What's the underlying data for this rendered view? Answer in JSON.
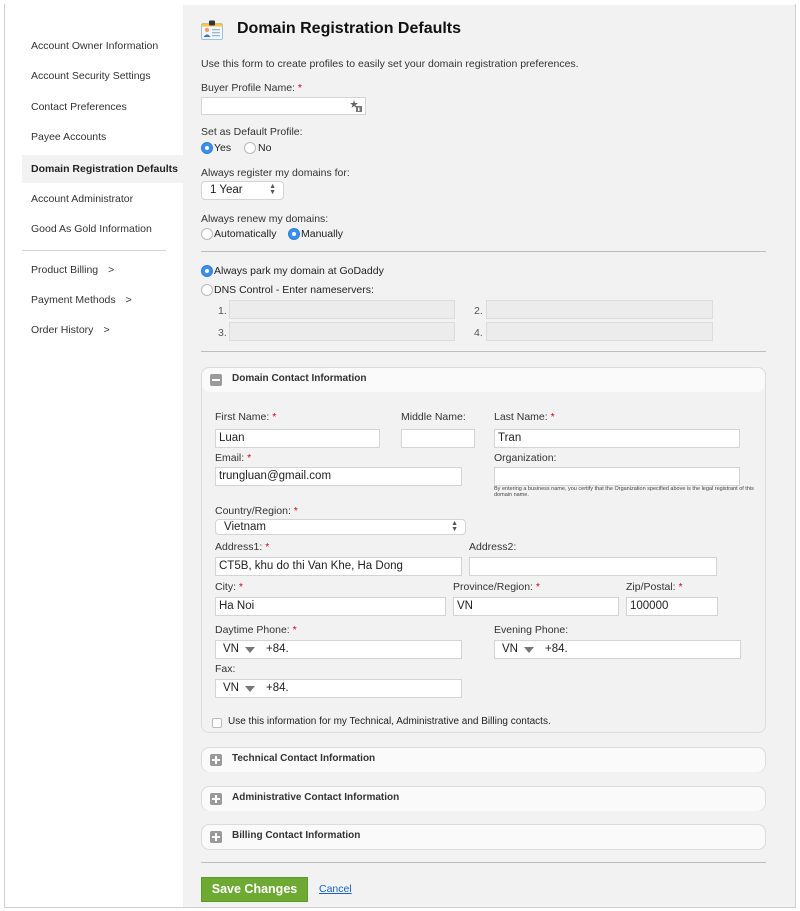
{
  "sidebar": {
    "items": [
      {
        "label": "Account Owner Information"
      },
      {
        "label": "Account Security Settings"
      },
      {
        "label": "Contact Preferences"
      },
      {
        "label": "Payee Accounts"
      },
      {
        "label": "Domain Registration Defaults",
        "active": true
      },
      {
        "label": "Account Administrator"
      },
      {
        "label": "Good As Gold Information"
      }
    ],
    "sub_items": [
      {
        "label": "Product Billing",
        "arrow": ">"
      },
      {
        "label": "Payment Methods",
        "arrow": ">"
      },
      {
        "label": "Order History",
        "arrow": ">"
      }
    ]
  },
  "header": {
    "icon": "id-card-icon",
    "title": "Domain Registration Defaults",
    "description": "Use this form to create profiles to easily set your domain registration preferences."
  },
  "form": {
    "required_mark": "*",
    "buyer_profile": {
      "label": "Buyer Profile Name:",
      "value": "",
      "icon": "autofill-icon"
    },
    "default_profile": {
      "label": "Set as Default Profile:",
      "options": [
        "Yes",
        "No"
      ],
      "selected": "Yes"
    },
    "register_for": {
      "label": "Always register my domains for:",
      "value": "1 Year"
    },
    "renew": {
      "label": "Always renew my domains:",
      "options": [
        "Automatically",
        "Manually"
      ],
      "selected": "Manually"
    },
    "nameservers": {
      "park_label": "Always park my domain at GoDaddy",
      "dns_label": "DNS Control - Enter nameservers:",
      "selected": "park",
      "fields": [
        {
          "num": "1.",
          "value": ""
        },
        {
          "num": "2.",
          "value": ""
        },
        {
          "num": "3.",
          "value": ""
        },
        {
          "num": "4.",
          "value": ""
        }
      ]
    }
  },
  "domain_contact": {
    "title": "Domain Contact Information",
    "expanded": true,
    "first_name": {
      "label": "First Name:",
      "value": "Luan"
    },
    "middle_name": {
      "label": "Middle Name:",
      "value": ""
    },
    "last_name": {
      "label": "Last Name:",
      "value": "Tran"
    },
    "email": {
      "label": "Email:",
      "value": "trungluan@gmail.com"
    },
    "organization": {
      "label": "Organization:",
      "value": "",
      "note": "By entering a business name, you certify that the Organization specified above is the legal registrant of this domain name."
    },
    "country": {
      "label": "Country/Region:",
      "value": "Vietnam"
    },
    "address1": {
      "label": "Address1:",
      "value": "CT5B, khu do thi Van Khe, Ha Dong"
    },
    "address2": {
      "label": "Address2:",
      "value": ""
    },
    "city": {
      "label": "City:",
      "value": "Ha Noi"
    },
    "province": {
      "label": "Province/Region:",
      "value": "VN"
    },
    "zip": {
      "label": "Zip/Postal:",
      "value": "100000"
    },
    "daytime_phone": {
      "label": "Daytime Phone:",
      "country": "VN",
      "prefix": "+84."
    },
    "evening_phone": {
      "label": "Evening Phone:",
      "country": "VN",
      "prefix": "+84."
    },
    "fax": {
      "label": "Fax:",
      "country": "VN",
      "prefix": "+84."
    },
    "use_for_all": {
      "label": "Use this information for my Technical, Administrative and Billing contacts.",
      "checked": false
    }
  },
  "collapsed_panels": [
    {
      "title": "Technical Contact Information"
    },
    {
      "title": "Administrative Contact Information"
    },
    {
      "title": "Billing Contact Information"
    }
  ],
  "actions": {
    "save_label": "Save Changes",
    "cancel_label": "Cancel"
  },
  "colors": {
    "accent_radio": "#3a8ef0",
    "save_green": "#6ea934",
    "required_red": "#d0021b",
    "link_blue": "#1a63c9"
  }
}
